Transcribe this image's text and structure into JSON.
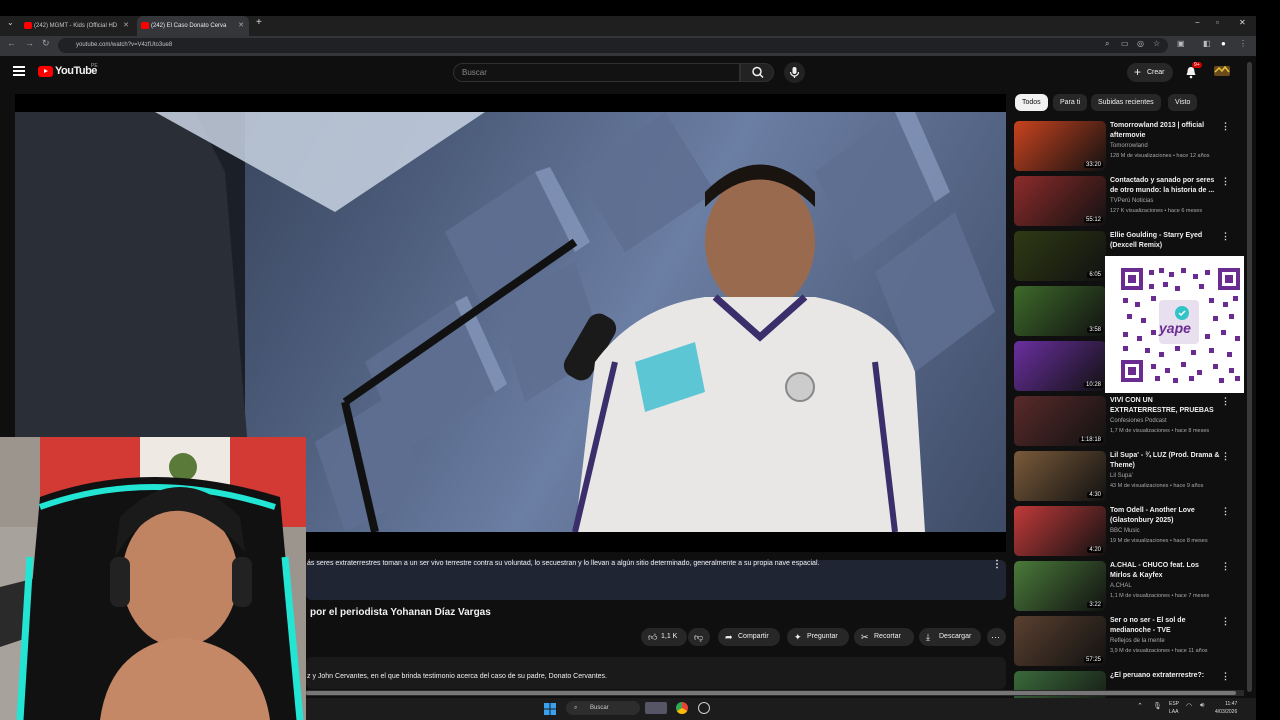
{
  "browser": {
    "tabs": [
      {
        "title": "(242) MGMT - Kids (Official HD",
        "active": false
      },
      {
        "title": "(242) El Caso Donato Cerva",
        "active": true
      }
    ],
    "new_tab": "+",
    "url": "youtube.com/watch?v=V4zfUto3ue8",
    "window_controls": [
      "−",
      "▫",
      "✕"
    ]
  },
  "header": {
    "logo": "YouTube",
    "country": "PE",
    "search_placeholder": "Buscar",
    "create_label": "Crear",
    "notifications_badge": "9+"
  },
  "video": {
    "description_snippet": "ás seres extraterrestres toman a un ser vivo terrestre contra su voluntad, lo secuestran y lo llevan a algún sitio determinado, generalmente a su propia nave espacial.",
    "title_fragment": "por el periodista Yohanan Díaz Vargas",
    "actions": {
      "like_count": "1,1 K",
      "share": "Compartir",
      "ask": "Preguntar",
      "clip": "Recortar",
      "download": "Descargar"
    },
    "description_line2": "z y John Cervantes, en el que brinda testimonio acerca del caso de su padre, Donato Cervantes."
  },
  "sidebar": {
    "chips": [
      "Todos",
      "Para ti",
      "Subidas recientes",
      "Visto"
    ],
    "items": [
      {
        "title": "Tomorrowland 2013 | official aftermovie",
        "channel": "Tomorrowland",
        "meta": "128 M de visualizaciones • hace 12 años",
        "duration": "33:20",
        "color": "#c9431f"
      },
      {
        "title": "Contactado y sanado por seres de otro mundo: la historia de ...",
        "channel": "TVPerú Noticias",
        "meta": "127 K visualizaciones • hace 6 meses",
        "duration": "55:12",
        "color": "#8e2b2b"
      },
      {
        "title": "Ellie Goulding - Starry Eyed (Dexcell Remix)",
        "channel": "",
        "meta": "",
        "duration": "6:05",
        "color": "#2f3a14"
      },
      {
        "title": "",
        "channel": "",
        "meta": "",
        "duration": "3:58",
        "color": "#3d6a2a"
      },
      {
        "title": "",
        "channel": "",
        "meta": "",
        "duration": "10:28",
        "color": "#6a2fa0"
      },
      {
        "title": "VIVÍ CON UN EXTRATERRESTRE, PRUEBAS ...",
        "channel": "Confesiones Podcast",
        "meta": "1,7 M de visualizaciones • hace 8 meses",
        "duration": "1:18:18",
        "color": "#5a2a2a"
      },
      {
        "title": "Lil Supa' - ¾ LUZ (Prod. Drama & Theme)",
        "channel": "Lil Supa'",
        "meta": "43 M de visualizaciones • hace 9 años",
        "duration": "4:30",
        "color": "#7a5a3a"
      },
      {
        "title": "Tom Odell - Another Love (Glastonbury 2025)",
        "channel": "BBC Music",
        "meta": "19 M de visualizaciones • hace 8 meses",
        "duration": "4:20",
        "color": "#c23a3a"
      },
      {
        "title": "A.CHAL - CHUCO feat. Los Mirlos & Kayfex",
        "channel": "A.CHAL",
        "meta": "1,1 M de visualizaciones • hace 7 meses",
        "duration": "3:22",
        "color": "#4a7a3a"
      },
      {
        "title": "Ser o no ser - El sol de medianoche - TVE",
        "channel": "Reflejos de la mente",
        "meta": "3,9 M de visualizaciones • hace 11 años",
        "duration": "57:25",
        "color": "#5a4030"
      },
      {
        "title": "¿El peruano extraterrestre?:",
        "channel": "",
        "meta": "",
        "duration": "",
        "color": "#3a6a3a"
      }
    ]
  },
  "overlay": {
    "qr_brand": "yape"
  },
  "taskbar": {
    "search_label": "Buscar",
    "time": "11:47",
    "date": "4/03/2026",
    "lang_top": "ESP",
    "lang_bottom": "LAA"
  }
}
